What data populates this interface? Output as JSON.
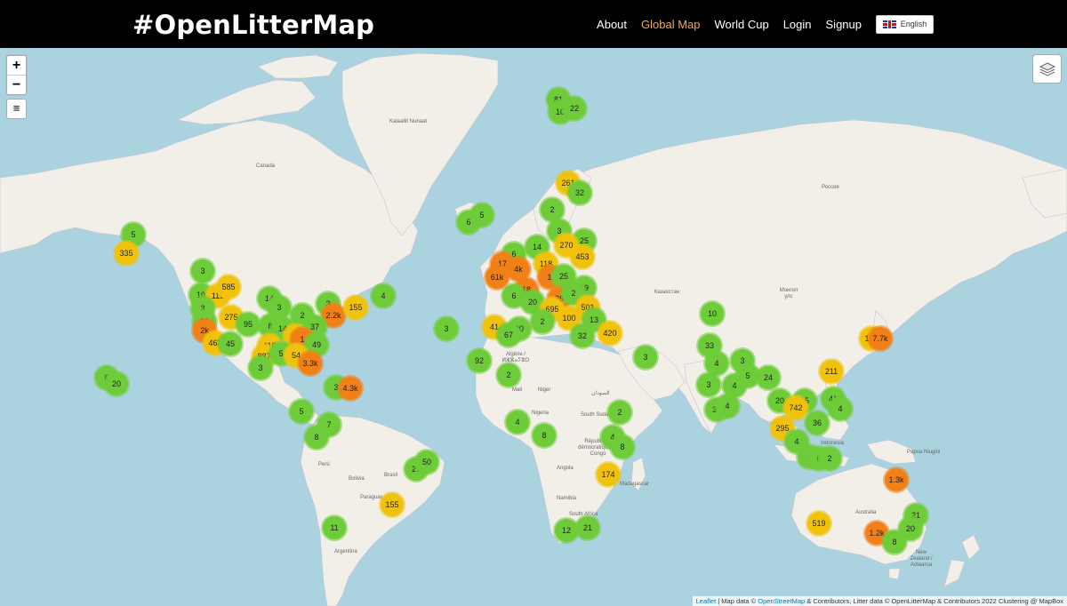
{
  "navbar": {
    "brand": "#OpenLitterMap",
    "links": [
      {
        "label": "About",
        "active": false
      },
      {
        "label": "Global Map",
        "active": true
      },
      {
        "label": "World Cup",
        "active": false
      },
      {
        "label": "Login",
        "active": false
      },
      {
        "label": "Signup",
        "active": false
      }
    ],
    "language": "English",
    "active_color": "#f5a95b"
  },
  "map_controls": {
    "zoom_in": "+",
    "zoom_out": "−",
    "menu": "≡"
  },
  "cluster_colors": {
    "small": "#6ecc39",
    "medium": "#f0c20c",
    "large": "#f18017"
  },
  "clusters": [
    {
      "count": "81",
      "size": "small"
    },
    {
      "count": "10",
      "size": "small"
    },
    {
      "count": "22",
      "size": "small"
    },
    {
      "count": "261",
      "size": "medium"
    },
    {
      "count": "32",
      "size": "small"
    },
    {
      "count": "6",
      "size": "small"
    },
    {
      "count": "5",
      "size": "small"
    },
    {
      "count": "2",
      "size": "small"
    },
    {
      "count": "3",
      "size": "small"
    },
    {
      "count": "25",
      "size": "small"
    },
    {
      "count": "14",
      "size": "small"
    },
    {
      "count": "270",
      "size": "medium"
    },
    {
      "count": "453",
      "size": "medium"
    },
    {
      "count": "6",
      "size": "small"
    },
    {
      "count": "118",
      "size": "medium"
    },
    {
      "count": "17",
      "size": "large"
    },
    {
      "count": "4k",
      "size": "large"
    },
    {
      "count": "61k",
      "size": "large"
    },
    {
      "count": "18",
      "size": "large"
    },
    {
      "count": "1",
      "size": "large"
    },
    {
      "count": "25",
      "size": "small"
    },
    {
      "count": "19",
      "size": "small"
    },
    {
      "count": "6",
      "size": "small"
    },
    {
      "count": "20",
      "size": "small"
    },
    {
      "count": "26",
      "size": "large"
    },
    {
      "count": "2",
      "size": "small"
    },
    {
      "count": "695",
      "size": "medium"
    },
    {
      "count": "501",
      "size": "medium"
    },
    {
      "count": "100",
      "size": "medium"
    },
    {
      "count": "13",
      "size": "small"
    },
    {
      "count": "41",
      "size": "medium"
    },
    {
      "count": "20",
      "size": "small"
    },
    {
      "count": "67",
      "size": "small"
    },
    {
      "count": "2",
      "size": "small"
    },
    {
      "count": "32",
      "size": "small"
    },
    {
      "count": "420",
      "size": "medium"
    },
    {
      "count": "3",
      "size": "small"
    },
    {
      "count": "92",
      "size": "small"
    },
    {
      "count": "2",
      "size": "small"
    },
    {
      "count": "3",
      "size": "small"
    },
    {
      "count": "4",
      "size": "small"
    },
    {
      "count": "8",
      "size": "small"
    },
    {
      "count": "2",
      "size": "small"
    },
    {
      "count": "4",
      "size": "small"
    },
    {
      "count": "8",
      "size": "small"
    },
    {
      "count": "174",
      "size": "medium"
    },
    {
      "count": "12",
      "size": "small"
    },
    {
      "count": "21",
      "size": "small"
    },
    {
      "count": "5",
      "size": "small"
    },
    {
      "count": "335",
      "size": "medium"
    },
    {
      "count": "3",
      "size": "small"
    },
    {
      "count": "10",
      "size": "small"
    },
    {
      "count": "112",
      "size": "medium"
    },
    {
      "count": "585",
      "size": "medium"
    },
    {
      "count": "3",
      "size": "small"
    },
    {
      "count": "275",
      "size": "medium"
    },
    {
      "count": "95",
      "size": "small"
    },
    {
      "count": "21",
      "size": "small"
    },
    {
      "count": "2k",
      "size": "large"
    },
    {
      "count": "463",
      "size": "medium"
    },
    {
      "count": "45",
      "size": "small"
    },
    {
      "count": "14",
      "size": "small"
    },
    {
      "count": "3",
      "size": "small"
    },
    {
      "count": "2",
      "size": "small"
    },
    {
      "count": "3",
      "size": "small"
    },
    {
      "count": "2.2k",
      "size": "large"
    },
    {
      "count": "155",
      "size": "medium"
    },
    {
      "count": "4",
      "size": "small"
    },
    {
      "count": "8",
      "size": "small"
    },
    {
      "count": "14",
      "size": "small"
    },
    {
      "count": "37",
      "size": "small"
    },
    {
      "count": "6",
      "size": "medium"
    },
    {
      "count": "1",
      "size": "large"
    },
    {
      "count": "49",
      "size": "small"
    },
    {
      "count": "418",
      "size": "medium"
    },
    {
      "count": "887",
      "size": "medium"
    },
    {
      "count": "5",
      "size": "small"
    },
    {
      "count": "54",
      "size": "medium"
    },
    {
      "count": "3.3k",
      "size": "large"
    },
    {
      "count": "3",
      "size": "small"
    },
    {
      "count": "6",
      "size": "small"
    },
    {
      "count": "20",
      "size": "small"
    },
    {
      "count": "3",
      "size": "small"
    },
    {
      "count": "4.3k",
      "size": "large"
    },
    {
      "count": "5",
      "size": "small"
    },
    {
      "count": "7",
      "size": "small"
    },
    {
      "count": "8",
      "size": "small"
    },
    {
      "count": "27",
      "size": "small"
    },
    {
      "count": "50",
      "size": "small"
    },
    {
      "count": "155",
      "size": "medium"
    },
    {
      "count": "11",
      "size": "small"
    },
    {
      "count": "10",
      "size": "small"
    },
    {
      "count": "33",
      "size": "small"
    },
    {
      "count": "4",
      "size": "small"
    },
    {
      "count": "3",
      "size": "small"
    },
    {
      "count": "3",
      "size": "small"
    },
    {
      "count": "4",
      "size": "small"
    },
    {
      "count": "5",
      "size": "small"
    },
    {
      "count": "24",
      "size": "small"
    },
    {
      "count": "30",
      "size": "small"
    },
    {
      "count": "4",
      "size": "small"
    },
    {
      "count": "20",
      "size": "small"
    },
    {
      "count": "15",
      "size": "small"
    },
    {
      "count": "742",
      "size": "medium"
    },
    {
      "count": "211",
      "size": "medium"
    },
    {
      "count": "41",
      "size": "small"
    },
    {
      "count": "4",
      "size": "small"
    },
    {
      "count": "295",
      "size": "medium"
    },
    {
      "count": "36",
      "size": "small"
    },
    {
      "count": "4",
      "size": "small"
    },
    {
      "count": "4",
      "size": "small"
    },
    {
      "count": "6",
      "size": "small"
    },
    {
      "count": "2",
      "size": "small"
    },
    {
      "count": "177",
      "size": "medium"
    },
    {
      "count": "7.7k",
      "size": "large"
    },
    {
      "count": "1.3k",
      "size": "large"
    },
    {
      "count": "21",
      "size": "small"
    },
    {
      "count": "20",
      "size": "small"
    },
    {
      "count": "519",
      "size": "medium"
    },
    {
      "count": "1.2k",
      "size": "large"
    },
    {
      "count": "8",
      "size": "small"
    }
  ],
  "map_labels": {
    "greenland": "Kalaallit Nunaat",
    "canada": "Canada",
    "russia": "Россия",
    "kazakhstan": "Казахстан",
    "mongolia": "Монгол улс",
    "algeria": "Algérie / ⵍⵣⵣⴰⵢⴻⵔ",
    "mali": "Mali",
    "niger": "Niger",
    "sudan": "السودان",
    "nigeria": "Nigeria",
    "south_sudan": "South Sudan",
    "drc": "République démocratique du Congo",
    "angola": "Angola",
    "namibia": "Namibia",
    "south_africa": "South Africa",
    "peru": "Perú",
    "bolivia": "Bolivia",
    "brasil": "Brasil",
    "paraguay": "Paraguay",
    "argentina": "Argentina",
    "australia": "Australia",
    "indonesia": "Indonesia",
    "papua": "Papua Niugini",
    "new_zealand": "New Zealand / Aotearoa",
    "madagascar": "Madagascar"
  },
  "attribution": {
    "leaflet": "Leaflet",
    "text1": " | Map data © ",
    "osm": "OpenStreetMap",
    "text2": " & Contributors, Litter data © OpenLitterMap & Contributors 2022 Clustering @ MapBox"
  }
}
